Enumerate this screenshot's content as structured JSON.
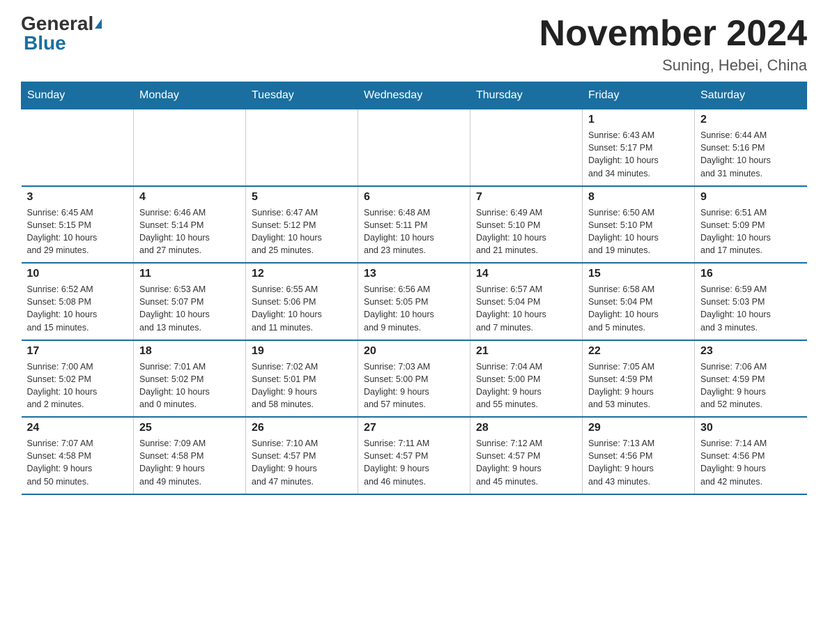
{
  "logo": {
    "general": "General",
    "blue": "Blue"
  },
  "title": "November 2024",
  "location": "Suning, Hebei, China",
  "weekdays": [
    "Sunday",
    "Monday",
    "Tuesday",
    "Wednesday",
    "Thursday",
    "Friday",
    "Saturday"
  ],
  "weeks": [
    [
      {
        "day": "",
        "info": ""
      },
      {
        "day": "",
        "info": ""
      },
      {
        "day": "",
        "info": ""
      },
      {
        "day": "",
        "info": ""
      },
      {
        "day": "",
        "info": ""
      },
      {
        "day": "1",
        "info": "Sunrise: 6:43 AM\nSunset: 5:17 PM\nDaylight: 10 hours\nand 34 minutes."
      },
      {
        "day": "2",
        "info": "Sunrise: 6:44 AM\nSunset: 5:16 PM\nDaylight: 10 hours\nand 31 minutes."
      }
    ],
    [
      {
        "day": "3",
        "info": "Sunrise: 6:45 AM\nSunset: 5:15 PM\nDaylight: 10 hours\nand 29 minutes."
      },
      {
        "day": "4",
        "info": "Sunrise: 6:46 AM\nSunset: 5:14 PM\nDaylight: 10 hours\nand 27 minutes."
      },
      {
        "day": "5",
        "info": "Sunrise: 6:47 AM\nSunset: 5:12 PM\nDaylight: 10 hours\nand 25 minutes."
      },
      {
        "day": "6",
        "info": "Sunrise: 6:48 AM\nSunset: 5:11 PM\nDaylight: 10 hours\nand 23 minutes."
      },
      {
        "day": "7",
        "info": "Sunrise: 6:49 AM\nSunset: 5:10 PM\nDaylight: 10 hours\nand 21 minutes."
      },
      {
        "day": "8",
        "info": "Sunrise: 6:50 AM\nSunset: 5:10 PM\nDaylight: 10 hours\nand 19 minutes."
      },
      {
        "day": "9",
        "info": "Sunrise: 6:51 AM\nSunset: 5:09 PM\nDaylight: 10 hours\nand 17 minutes."
      }
    ],
    [
      {
        "day": "10",
        "info": "Sunrise: 6:52 AM\nSunset: 5:08 PM\nDaylight: 10 hours\nand 15 minutes."
      },
      {
        "day": "11",
        "info": "Sunrise: 6:53 AM\nSunset: 5:07 PM\nDaylight: 10 hours\nand 13 minutes."
      },
      {
        "day": "12",
        "info": "Sunrise: 6:55 AM\nSunset: 5:06 PM\nDaylight: 10 hours\nand 11 minutes."
      },
      {
        "day": "13",
        "info": "Sunrise: 6:56 AM\nSunset: 5:05 PM\nDaylight: 10 hours\nand 9 minutes."
      },
      {
        "day": "14",
        "info": "Sunrise: 6:57 AM\nSunset: 5:04 PM\nDaylight: 10 hours\nand 7 minutes."
      },
      {
        "day": "15",
        "info": "Sunrise: 6:58 AM\nSunset: 5:04 PM\nDaylight: 10 hours\nand 5 minutes."
      },
      {
        "day": "16",
        "info": "Sunrise: 6:59 AM\nSunset: 5:03 PM\nDaylight: 10 hours\nand 3 minutes."
      }
    ],
    [
      {
        "day": "17",
        "info": "Sunrise: 7:00 AM\nSunset: 5:02 PM\nDaylight: 10 hours\nand 2 minutes."
      },
      {
        "day": "18",
        "info": "Sunrise: 7:01 AM\nSunset: 5:02 PM\nDaylight: 10 hours\nand 0 minutes."
      },
      {
        "day": "19",
        "info": "Sunrise: 7:02 AM\nSunset: 5:01 PM\nDaylight: 9 hours\nand 58 minutes."
      },
      {
        "day": "20",
        "info": "Sunrise: 7:03 AM\nSunset: 5:00 PM\nDaylight: 9 hours\nand 57 minutes."
      },
      {
        "day": "21",
        "info": "Sunrise: 7:04 AM\nSunset: 5:00 PM\nDaylight: 9 hours\nand 55 minutes."
      },
      {
        "day": "22",
        "info": "Sunrise: 7:05 AM\nSunset: 4:59 PM\nDaylight: 9 hours\nand 53 minutes."
      },
      {
        "day": "23",
        "info": "Sunrise: 7:06 AM\nSunset: 4:59 PM\nDaylight: 9 hours\nand 52 minutes."
      }
    ],
    [
      {
        "day": "24",
        "info": "Sunrise: 7:07 AM\nSunset: 4:58 PM\nDaylight: 9 hours\nand 50 minutes."
      },
      {
        "day": "25",
        "info": "Sunrise: 7:09 AM\nSunset: 4:58 PM\nDaylight: 9 hours\nand 49 minutes."
      },
      {
        "day": "26",
        "info": "Sunrise: 7:10 AM\nSunset: 4:57 PM\nDaylight: 9 hours\nand 47 minutes."
      },
      {
        "day": "27",
        "info": "Sunrise: 7:11 AM\nSunset: 4:57 PM\nDaylight: 9 hours\nand 46 minutes."
      },
      {
        "day": "28",
        "info": "Sunrise: 7:12 AM\nSunset: 4:57 PM\nDaylight: 9 hours\nand 45 minutes."
      },
      {
        "day": "29",
        "info": "Sunrise: 7:13 AM\nSunset: 4:56 PM\nDaylight: 9 hours\nand 43 minutes."
      },
      {
        "day": "30",
        "info": "Sunrise: 7:14 AM\nSunset: 4:56 PM\nDaylight: 9 hours\nand 42 minutes."
      }
    ]
  ]
}
